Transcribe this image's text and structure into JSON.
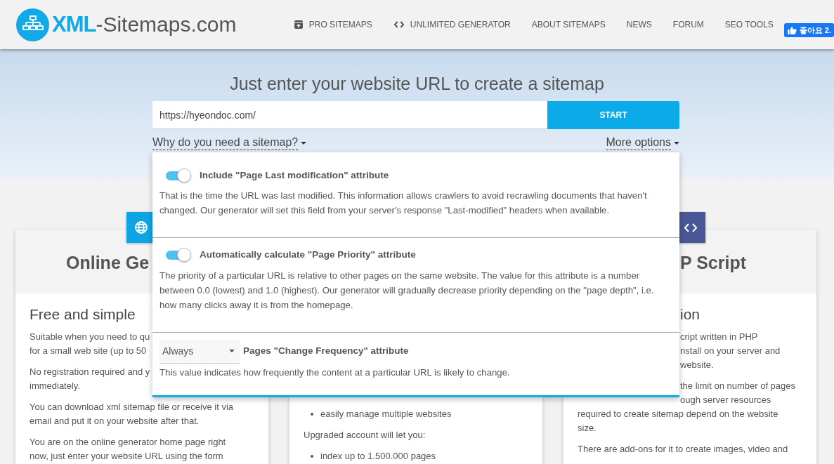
{
  "header": {
    "logo": {
      "bold": "XML",
      "rest": "-Sitemaps.com"
    },
    "nav": [
      {
        "kind": "icon_link",
        "label": "PRO SITEMAPS"
      },
      {
        "kind": "icon_link",
        "label": "UNLIMITED GENERATOR"
      },
      {
        "kind": "link",
        "label": "ABOUT SITEMAPS"
      },
      {
        "kind": "link",
        "label": "NEWS"
      },
      {
        "kind": "link",
        "label": "FORUM"
      },
      {
        "kind": "link",
        "label": "SEO TOOLS"
      }
    ],
    "like_button": {
      "label": "좋아요 2."
    }
  },
  "hero": {
    "title": "Just enter your website URL to create a sitemap",
    "url_field": {
      "value": "https://hyeondoc.com/"
    },
    "start_button": "START",
    "links": [
      "Why do you need a sitemap?",
      "More options"
    ]
  },
  "cards": [
    {
      "color": "#0ea5e4",
      "title": "Online Ge",
      "subtitle": "Free and simple",
      "paragraphs": [
        {
          "kind": "text",
          "lines": [
            {
              "text": "Suitable when you need to qu"
            },
            {
              "text": "for a small web site (up to 50"
            }
          ]
        },
        {
          "kind": "text",
          "lines": [
            {
              "text": "No registration required and y"
            },
            {
              "text": "immediately."
            }
          ]
        },
        {
          "kind": "text",
          "lines": [
            {
              "text": "You can download xml sitemap file or receive it via"
            },
            {
              "text": "email and put it on your website after that."
            }
          ]
        },
        {
          "kind": "text",
          "lines": [
            {
              "text": "You are on the online generator home page right"
            },
            {
              "text": "now, just enter your website URL using the form"
            }
          ]
        }
      ]
    },
    {
      "paragraphs": [
        {
          "kind": "bullet",
          "lines": [
            {
              "text": "easily manage multiple websites"
            }
          ]
        },
        {
          "kind": "text",
          "lines": [
            {
              "text": "Upgraded account will let you:"
            }
          ]
        },
        {
          "kind": "bullet",
          "lines": [
            {
              "text": "index up to 1.500.000 pages"
            }
          ]
        }
      ]
    },
    {
      "color": "#4a5796",
      "title": "P Script",
      "subtitle": "ion",
      "paragraphs": [
        {
          "kind": "text",
          "lines": [
            {
              "text": "cript written in PHP",
              "covered_left": true
            },
            {
              "text": "nstall on your server and",
              "covered_left": true
            },
            {
              "text": "website.",
              "covered_left": true
            }
          ]
        },
        {
          "kind": "text",
          "lines": [
            {
              "text": "the limit on number of pages",
              "covered_left": true
            },
            {
              "text": "ough server resources",
              "covered_left": true
            },
            {
              "text": "required to create sitemap depend on the website"
            },
            {
              "text": "size."
            }
          ]
        },
        {
          "kind": "text",
          "lines": [
            {
              "text": "There are add-ons for it to create images, video and"
            }
          ]
        }
      ]
    }
  ],
  "options_panel": {
    "options": [
      {
        "kind": "toggle",
        "on": true,
        "title": "Include \"Page Last modification\" attribute",
        "description": "That is the time the URL was last modified. This information allows crawlers to avoid recrawling documents that haven't changed. Our generator will set this field from your server's response \"Last-modified\" headers when available."
      },
      {
        "kind": "toggle",
        "on": true,
        "title": "Automatically calculate \"Page Priority\" attribute",
        "description": "The priority of a particular URL is relative to other pages on the same website. The value for this attribute is a number between 0.0 (lowest) and 1.0 (highest). Our generator will gradually decrease priority depending on the \"page depth\", i.e. how many clicks away it is from the homepage."
      },
      {
        "kind": "select",
        "value": "Always",
        "title": "Pages \"Change Frequency\" attribute",
        "description": "This value indicates how frequently the content at a particular URL is likely to change."
      }
    ]
  }
}
